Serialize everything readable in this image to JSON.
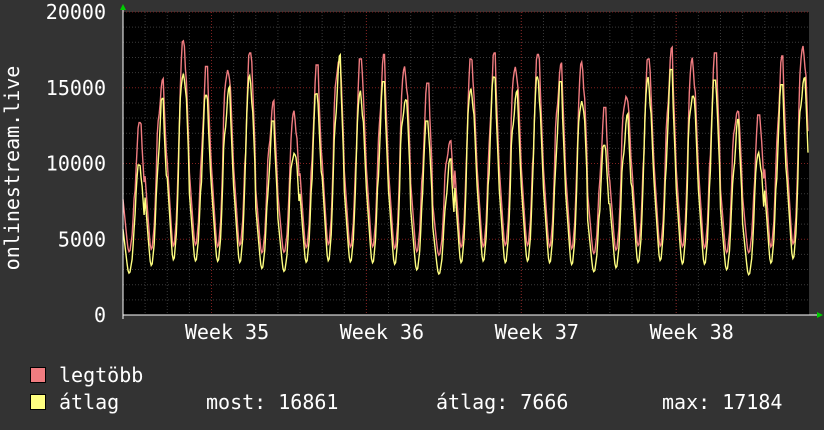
{
  "chart_data": {
    "type": "line",
    "ylabel": "onlinestream.live",
    "ylim": [
      0,
      20000
    ],
    "yticks": [
      {
        "value": 0,
        "label": "0"
      },
      {
        "value": 5000,
        "label": "5000"
      },
      {
        "value": 10000,
        "label": "10000"
      },
      {
        "value": 15000,
        "label": "15000"
      },
      {
        "value": 20000,
        "label": "20000"
      }
    ],
    "xticks": [
      {
        "day": 4.7,
        "label": "Week 35"
      },
      {
        "day": 11.7,
        "label": "Week 36"
      },
      {
        "day": 18.7,
        "label": "Week 37"
      },
      {
        "day": 25.7,
        "label": "Week 38"
      }
    ],
    "xlim_days": [
      0,
      31
    ],
    "grid": true,
    "series": [
      {
        "name": "legtöbb",
        "color": "#f07c80",
        "daily_peaks": [
          12700,
          16200,
          18100,
          16400,
          17300,
          17300,
          14300,
          13500,
          16500,
          18100,
          16900,
          17200,
          16900,
          15300,
          12100,
          16900,
          17300,
          17300,
          17200,
          17100,
          16700,
          13700,
          15500,
          16900,
          17700,
          17200,
          17300,
          14400,
          13200,
          17100,
          18500
        ],
        "daily_mins": [
          3500,
          3400,
          3500,
          3700,
          3500,
          3600,
          3300,
          3400,
          3500,
          3600,
          3500,
          3500,
          3400,
          3300,
          3300,
          3500,
          3500,
          3600,
          3600,
          3500,
          3400,
          3300,
          3400,
          3600,
          3500,
          3500,
          3400,
          3300,
          3400,
          3500,
          3600
        ]
      },
      {
        "name": "átlag",
        "color": "#ffff80",
        "daily_peaks": [
          9900,
          14300,
          16900,
          14500,
          15500,
          15800,
          12800,
          11500,
          14600,
          17200,
          15000,
          15400,
          15300,
          12800,
          10300,
          15600,
          15700,
          15500,
          15700,
          15400,
          15100,
          11200,
          13500,
          15700,
          16200,
          15700,
          15500,
          12900,
          11000,
          15200,
          16700
        ],
        "daily_mins": [
          2200,
          2400,
          2600,
          2700,
          2600,
          2500,
          2300,
          2200,
          2600,
          2500,
          2600,
          2500,
          2400,
          2200,
          2100,
          2500,
          2600,
          2500,
          2600,
          2500,
          2400,
          2200,
          2300,
          2500,
          2600,
          2400,
          2400,
          2200,
          2000,
          2500,
          2700
        ]
      }
    ]
  },
  "legend": {
    "items": [
      {
        "label": "legtöbb",
        "color": "#f07c80"
      },
      {
        "label": "átlag",
        "color": "#ffff80"
      }
    ],
    "stats": {
      "now": "most: 16861",
      "avg": "átlag: 7666",
      "max": "max: 17184"
    }
  },
  "colors": {
    "background": "#333333",
    "plot_background": "#000000",
    "grid_major": "#802020",
    "grid_minor": "#3a3a3a",
    "axis_arrow": "#00cc00"
  }
}
